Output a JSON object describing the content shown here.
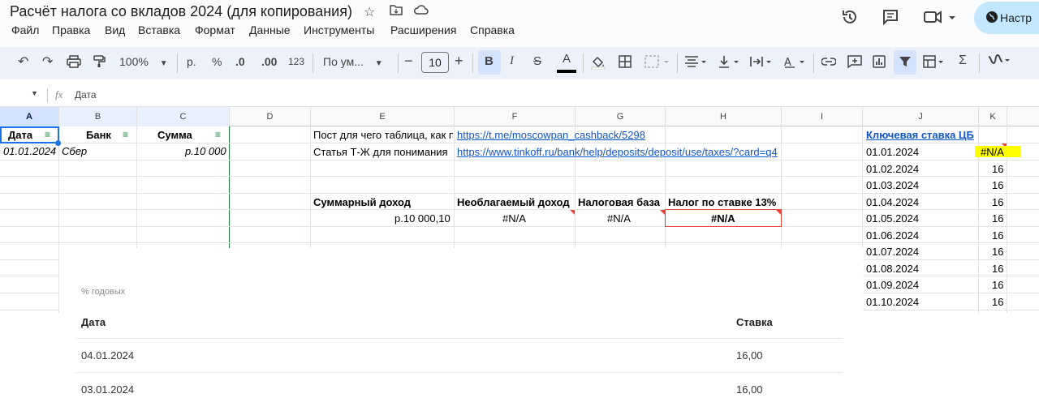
{
  "titlebar": {
    "doc_title": "Расчёт налога со вкладов 2024 (для копирования)",
    "share_label": "Настр",
    "icons": [
      "star-icon",
      "move-to-folder-icon",
      "cloud-saved-icon",
      "history-icon",
      "comments-icon",
      "meet-icon",
      "globe-icon"
    ]
  },
  "menu": [
    "Файл",
    "Правка",
    "Вид",
    "Вставка",
    "Формат",
    "Данные",
    "Инструменты",
    "Расширения",
    "Справка"
  ],
  "toolbar": {
    "zoom": "100%",
    "currency": "р.",
    "percent": "%",
    "dec_less": ".0",
    "dec_more": ".00",
    "more_formats": "123",
    "font_family": "По ум...",
    "font_size": "10",
    "minus": "−",
    "plus": "+",
    "sum": "Σ",
    "active_color": "#d3e3fd"
  },
  "formula_bar": {
    "cell_ref": "",
    "fx": "fx",
    "content": "Дата"
  },
  "columns": [
    "A",
    "B",
    "C",
    "D",
    "E",
    "F",
    "G",
    "H",
    "I",
    "J",
    "K"
  ],
  "cells": {
    "a1": "Дата",
    "b1": "Банк",
    "c1": "Сумма",
    "a2": "01.01.2024",
    "b2": "Сбер",
    "c2": "р.10 000",
    "e1": "Пост для чего таблица, как п",
    "f1": "https://t.me/moscowpan_cashback/5298",
    "e2": "Статья Т-Ж для понимания",
    "f2": "https://www.tinkoff.ru/bank/help/deposits/deposit/use/taxes/?card=q4",
    "e5": "Суммарный доход",
    "f5": "Необлагаемый доход",
    "g5": "Налоговая база",
    "h5": "Налог по ставке 13%",
    "e6": "р.10 000,10",
    "f6": "#N/A",
    "g6": "#N/A",
    "h6": "#N/A",
    "j1": "Ключевая ставка ЦБ",
    "j_dates": [
      "01.01.2024",
      "01.02.2024",
      "01.03.2024",
      "01.04.2024",
      "01.05.2024",
      "01.06.2024",
      "01.07.2024",
      "01.08.2024",
      "01.09.2024",
      "01.10.2024"
    ],
    "k_values": [
      "#N/A",
      "16",
      "16",
      "16",
      "16",
      "16",
      "16",
      "16",
      "16",
      "16"
    ]
  },
  "overlay": {
    "unit_label": "% годовых",
    "header_date": "Дата",
    "header_rate": "Ставка",
    "rows": [
      {
        "date": "04.01.2024",
        "rate": "16,00"
      },
      {
        "date": "03.01.2024",
        "rate": "16,00"
      }
    ]
  },
  "colors": {
    "highlight_yellow": "#ffff00",
    "link_blue": "#1155cc",
    "filter_green": "#188038",
    "error_red": "#ea4335"
  }
}
